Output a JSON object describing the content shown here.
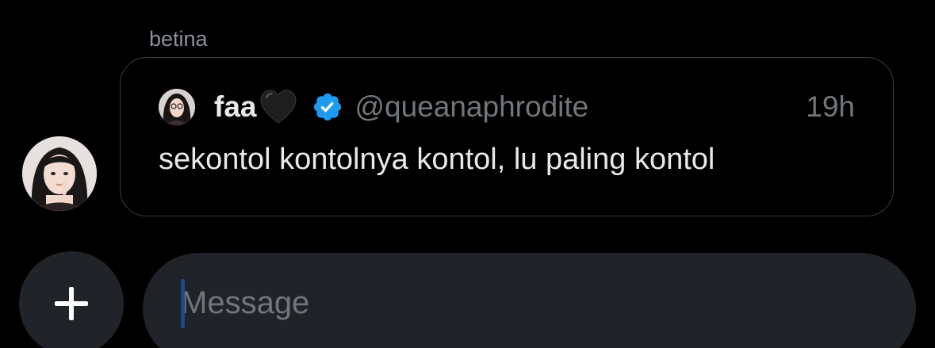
{
  "conversation": {
    "sender_name": "betina",
    "sender_avatar_icon": "user-avatar"
  },
  "quoted_tweet": {
    "author_name": "faa",
    "name_emoji": "black-heart-icon",
    "verified_icon": "verified-badge-icon",
    "author_handle": "@queanaphrodite",
    "timestamp": "19h",
    "text": "sekontol kontolnya kontol, lu paling kontol"
  },
  "composer": {
    "add_icon": "plus-icon",
    "placeholder": "Message"
  },
  "colors": {
    "background": "#000000",
    "card_border": "#3a3d40",
    "input_bg": "#202327",
    "primary_text": "#e7e9ea",
    "secondary_text": "#71767b",
    "verified_blue": "#1d9bf0"
  }
}
